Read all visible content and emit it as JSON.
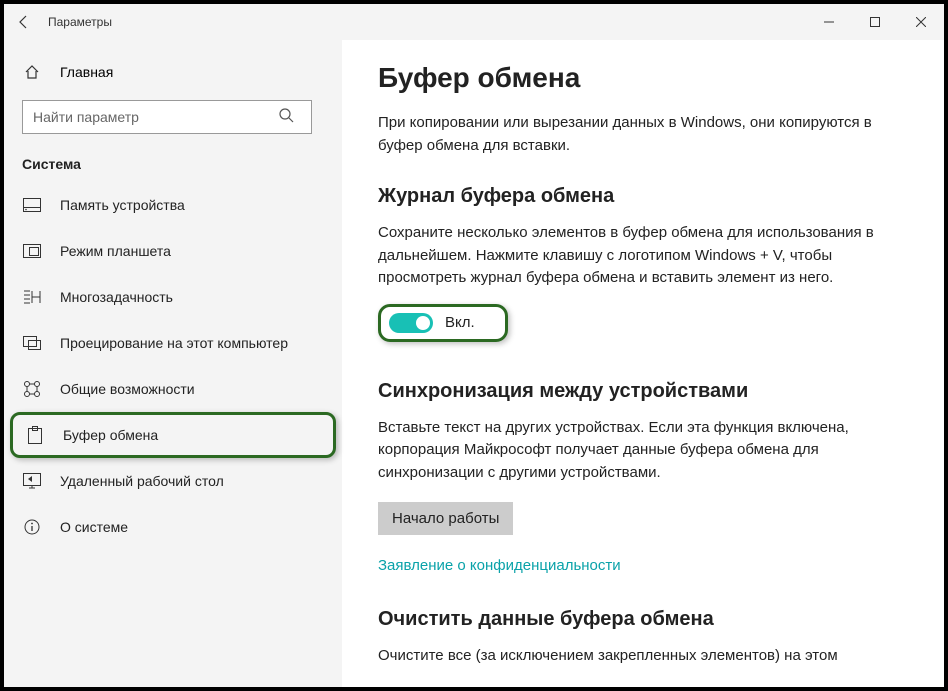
{
  "app_title": "Параметры",
  "search": {
    "placeholder": "Найти параметр"
  },
  "home_label": "Главная",
  "category_label": "Система",
  "nav_items": [
    {
      "label": "Память устройства"
    },
    {
      "label": "Режим планшета"
    },
    {
      "label": "Многозадачность"
    },
    {
      "label": "Проецирование на этот компьютер"
    },
    {
      "label": "Общие возможности"
    },
    {
      "label": "Буфер обмена"
    },
    {
      "label": "Удаленный рабочий стол"
    },
    {
      "label": "О системе"
    }
  ],
  "page": {
    "title": "Буфер обмена",
    "intro": "При копировании или вырезании данных в Windows, они копируются в буфер обмена для вставки.",
    "history": {
      "title": "Журнал буфера обмена",
      "desc": "Сохраните несколько элементов в буфер обмена для использования в дальнейшем. Нажмите клавишу с логотипом Windows + V, чтобы просмотреть журнал буфера обмена и вставить элемент из него.",
      "toggle_label": "Вкл."
    },
    "sync": {
      "title": "Синхронизация между устройствами",
      "desc": "Вставьте текст на других устройствах. Если эта функция включена, корпорация Майкрософт получает данные буфера обмена для синхронизации с другими устройствами.",
      "button": "Начало работы",
      "privacy_link": "Заявление о конфиденциальности"
    },
    "clear": {
      "title": "Очистить данные буфера обмена",
      "desc": "Очистите все (за исключением закрепленных элементов) на этом"
    }
  }
}
